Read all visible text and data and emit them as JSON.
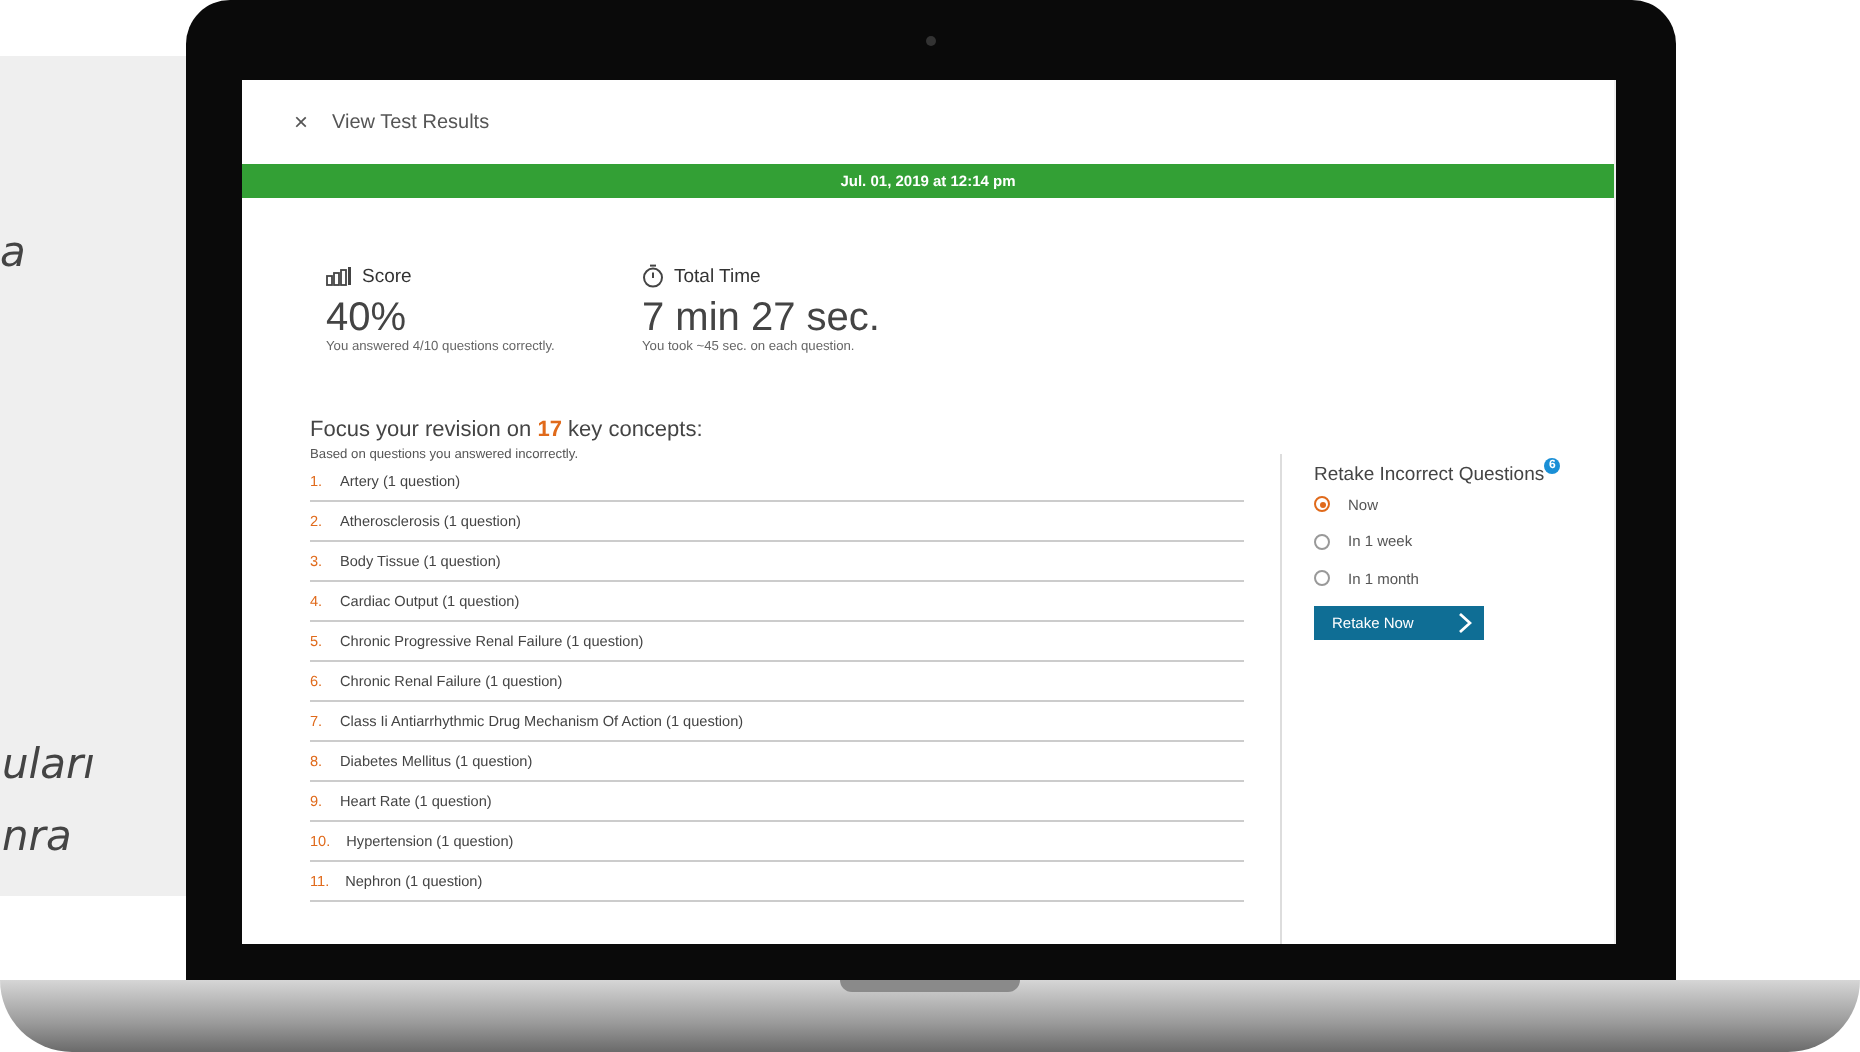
{
  "background_text": [
    "a",
    "uları",
    "nra"
  ],
  "header": {
    "close": "×",
    "title": "View Test Results"
  },
  "banner": "Jul. 01, 2019 at 12:14 pm",
  "stats": [
    {
      "kind": "score",
      "label": "Score",
      "value": "40%",
      "note": "You answered 4/10 questions correctly."
    },
    {
      "kind": "time",
      "label": "Total Time",
      "value": "7 min 27 sec.",
      "note": "You took ~45 sec. on each question."
    }
  ],
  "focus": {
    "heading": "Focus your revision on **17** key concepts:",
    "subheading": "Based on questions you answered incorrectly.",
    "concepts": [
      {
        "number": "1.",
        "text": "Artery (1 question)"
      },
      {
        "number": "2.",
        "text": "Atherosclerosis (1 question)"
      },
      {
        "number": "3.",
        "text": "Body Tissue (1 question)"
      },
      {
        "number": "4.",
        "text": "Cardiac Output (1 question)"
      },
      {
        "number": "5.",
        "text": "Chronic Progressive Renal Failure (1 question)"
      },
      {
        "number": "6.",
        "text": "Chronic Renal Failure (1 question)"
      },
      {
        "number": "7.",
        "text": "Class Ii Antiarrhythmic Drug Mechanism Of Action (1 question)"
      },
      {
        "number": "8.",
        "text": "Diabetes Mellitus (1 question)"
      },
      {
        "number": "9.",
        "text": "Heart Rate (1 question)"
      },
      {
        "number": "10.",
        "text": "Hypertension (1 question)"
      },
      {
        "number": "11.",
        "text": "Nephron (1 question)"
      }
    ]
  },
  "retake": {
    "title": "Retake Incorrect Questions",
    "badge": "6",
    "options": [
      {
        "label": "Now",
        "selected": true
      },
      {
        "label": "In 1 week",
        "selected": false
      },
      {
        "label": "In 1 month",
        "selected": false
      }
    ],
    "button": "Retake Now"
  }
}
